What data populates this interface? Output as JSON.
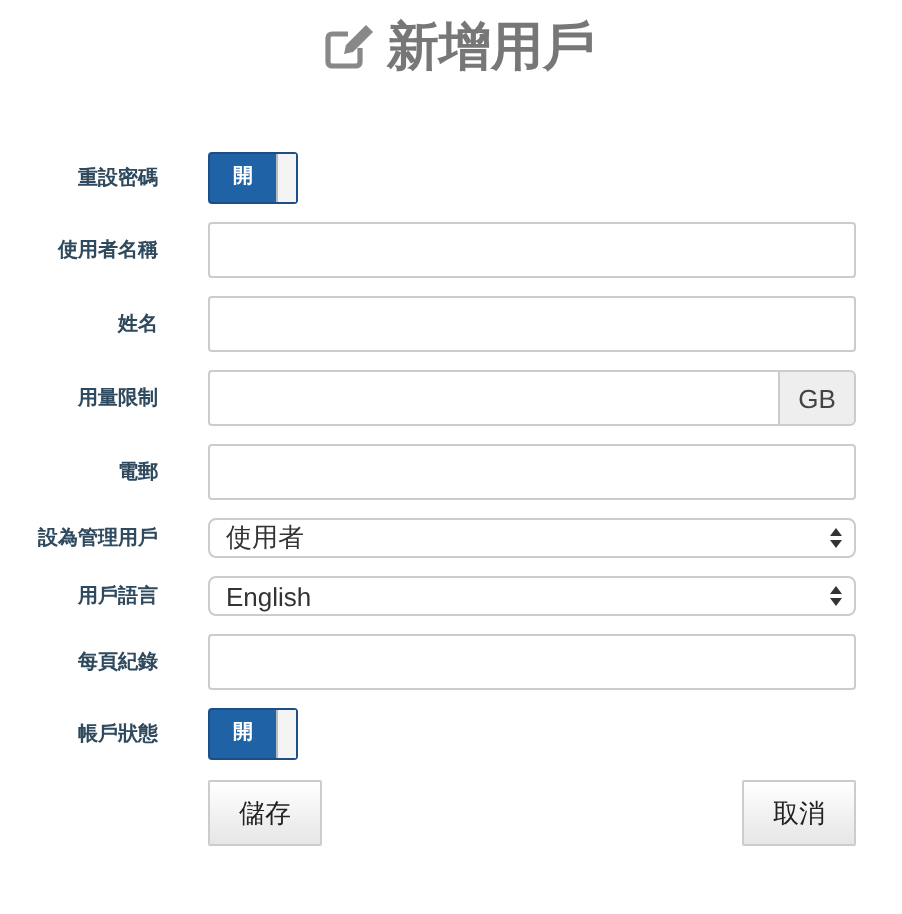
{
  "title": "新增用戶",
  "fields": [
    {
      "label": "重設密碼",
      "kind": "toggle",
      "on": true,
      "toggle_text": "開"
    },
    {
      "label": "使用者名稱",
      "kind": "text"
    },
    {
      "label": "姓名",
      "kind": "text"
    },
    {
      "label": "用量限制",
      "kind": "addon",
      "addon": "GB"
    },
    {
      "label": "電郵",
      "kind": "text"
    },
    {
      "label": "設為管理用戶",
      "kind": "select",
      "value": "使用者"
    },
    {
      "label": "用戶語言",
      "kind": "select",
      "value": "English"
    },
    {
      "label": "每頁紀錄",
      "kind": "text"
    },
    {
      "label": "帳戶狀態",
      "kind": "toggle",
      "on": true,
      "toggle_text": "開"
    }
  ],
  "buttons": [
    "儲存",
    "取消"
  ]
}
